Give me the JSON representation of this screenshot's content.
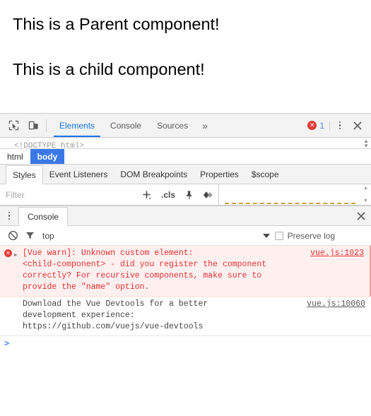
{
  "page": {
    "heading_parent": "This is a Parent component!",
    "heading_child": "This is a child component!"
  },
  "devtools": {
    "toolbar": {
      "inspect_icon": "inspect-element-icon",
      "device_icon": "device-toolbar-icon",
      "tabs": [
        {
          "label": "Elements",
          "active": true
        },
        {
          "label": "Console",
          "active": false
        },
        {
          "label": "Sources",
          "active": false
        }
      ],
      "more_tabs": "»",
      "error_count": "1",
      "error_glyph": "✕",
      "menu_icon": "more-options-icon",
      "close_icon": "close-devtools-icon"
    },
    "dom": {
      "doctype_line": "<!DOCTYPE html>"
    },
    "breadcrumb": [
      {
        "label": "html",
        "selected": false
      },
      {
        "label": "body",
        "selected": true
      }
    ],
    "styles_tabs": [
      {
        "label": "Styles",
        "active": true
      },
      {
        "label": "Event Listeners",
        "active": false
      },
      {
        "label": "DOM Breakpoints",
        "active": false
      },
      {
        "label": "Properties",
        "active": false
      },
      {
        "label": "$scope",
        "active": false
      }
    ],
    "styles_filter": {
      "placeholder": "Filter",
      "value": "",
      "new_rule_icon": "plus-icon",
      "cls_label": ".cls",
      "pin_icon": "pin-icon",
      "computed_icon": "computed-styles-icon"
    },
    "drawer": {
      "menu_icon": "drawer-menu-icon",
      "tabs": [
        {
          "label": "Console",
          "active": true
        }
      ],
      "close_icon": "close-drawer-icon",
      "console_toolbar": {
        "clear_icon": "clear-console-icon",
        "filter_icon": "filter-icon",
        "context": "top",
        "context_caret": "context-dropdown-caret",
        "preserve_log_label": "Preserve log",
        "preserve_log_checked": false
      },
      "messages": [
        {
          "type": "error",
          "icon": "error-icon",
          "expand": "▶",
          "text": "[Vue warn]: Unknown custom element:\n<child-component> - did you register the component\ncorrectly? For recursive components, make sure to\nprovide the \"name\" option.",
          "source": "vue.js:1023"
        },
        {
          "type": "info",
          "icon": "",
          "expand": "",
          "text": "Download the Vue Devtools for a better\ndevelopment experience:\nhttps://github.com/vuejs/vue-devtools",
          "source": "vue.js:10060"
        }
      ],
      "prompt": ">"
    }
  },
  "colors": {
    "accent": "#1a73e8",
    "selected_crumb": "#3b78e7",
    "error_red": "#e53935",
    "error_text": "#e03131",
    "error_bg": "#fff0f0",
    "toolbar_bg": "#f3f3f3"
  }
}
